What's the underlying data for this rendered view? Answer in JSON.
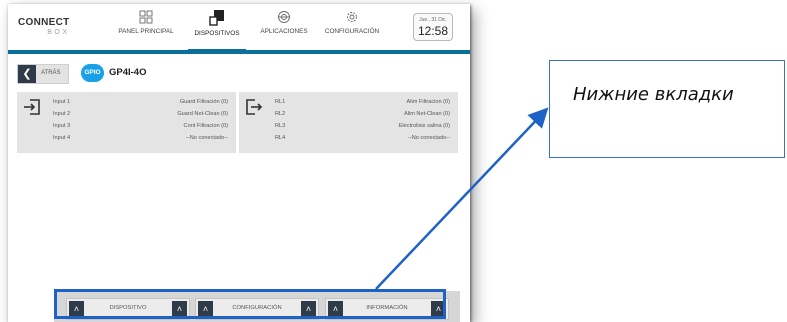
{
  "app": {
    "logo_top": "CONNECT",
    "logo_bottom": "BOX"
  },
  "nav": [
    {
      "label": "PANEL PRINCIPAL",
      "icon": "grid-icon"
    },
    {
      "label": "DISPOSITIVOS",
      "icon": "devices-icon"
    },
    {
      "label": "APLICACIONES",
      "icon": "applications-icon"
    },
    {
      "label": "CONFIGURACIÓN",
      "icon": "gear-icon"
    }
  ],
  "clock": {
    "date": "Jue., 31 Dic.",
    "time": "12:58"
  },
  "subheader": {
    "back_label": "ATRÁS",
    "badge": "GPIO",
    "device_name": "GP4I-4O"
  },
  "inputs": [
    {
      "name": "Input 1",
      "value": "Guard Filtración (0)"
    },
    {
      "name": "Input 2",
      "value": "Guard Net-Clean (0)"
    },
    {
      "name": "Input 3",
      "value": "Cont Filtracion (0)"
    },
    {
      "name": "Input 4",
      "value": "--No conectado--"
    }
  ],
  "outputs": [
    {
      "name": "RL1",
      "value": "Alim Filtracion (0)"
    },
    {
      "name": "RL2",
      "value": "Alim Net-Clean (0)"
    },
    {
      "name": "RL3",
      "value": "Electrolisis salina (0)"
    },
    {
      "name": "RL4",
      "value": "--No conectado--"
    }
  ],
  "bottom_tabs": [
    {
      "label": "DISPOSITIVO"
    },
    {
      "label": "CONFIGURACIÓN"
    },
    {
      "label": "INFORMACIÓN"
    }
  ],
  "annotation": {
    "text": "Нижние вкладки"
  },
  "colors": {
    "accent": "#0c6e9a",
    "badge": "#1aa0e8",
    "highlight": "#1f62c7",
    "dark_button": "#2f3b48"
  }
}
